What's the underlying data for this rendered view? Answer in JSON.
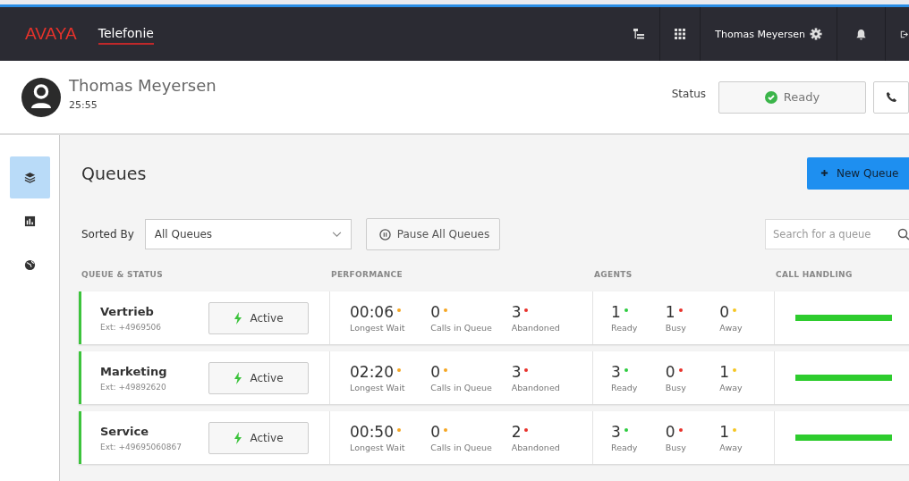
{
  "header": {
    "logo": "AVAYA",
    "app_title": "Telefonie",
    "user_name": "Thomas Meyersen"
  },
  "agent": {
    "name": "Thomas Meyersen",
    "timer": "25:55",
    "status_label": "Status",
    "status": "Ready"
  },
  "sidebar": {
    "items": [
      {
        "kind": "layers",
        "selected": true
      },
      {
        "kind": "chart",
        "selected": false
      },
      {
        "kind": "globe",
        "selected": false
      }
    ]
  },
  "page": {
    "title": "Queues",
    "new_button": "New Queue",
    "sort_label": "Sorted By",
    "sort_value": "All Queues",
    "pause_button": "Pause All Queues",
    "search": {
      "placeholder": "Search for a queue"
    }
  },
  "table": {
    "columns": [
      "QUEUE & STATUS",
      "PERFORMANCE",
      "AGENTS",
      "CALL HANDLING"
    ],
    "rows": [
      {
        "name": "Vertrieb",
        "ext": "Ext: +4969506",
        "status": "Active",
        "performance": [
          {
            "value": "00:06",
            "label": "Longest Wait",
            "color": "#f5a623"
          },
          {
            "value": "0",
            "label": "Calls in Queue",
            "color": "#f5a623"
          },
          {
            "value": "3",
            "label": "Abandoned",
            "color": "#e8322b"
          }
        ],
        "agents": [
          {
            "value": "1",
            "label": "Ready",
            "color": "#2ecc40"
          },
          {
            "value": "1",
            "label": "Busy",
            "color": "#e8322b"
          },
          {
            "value": "0",
            "label": "Away",
            "color": "#f5c623"
          }
        ]
      },
      {
        "name": "Marketing",
        "ext": "Ext: +49892620",
        "status": "Active",
        "performance": [
          {
            "value": "02:20",
            "label": "Longest Wait",
            "color": "#f5a623"
          },
          {
            "value": "0",
            "label": "Calls in Queue",
            "color": "#f5a623"
          },
          {
            "value": "3",
            "label": "Abandoned",
            "color": "#e8322b"
          }
        ],
        "agents": [
          {
            "value": "3",
            "label": "Ready",
            "color": "#2ecc40"
          },
          {
            "value": "0",
            "label": "Busy",
            "color": "#e8322b"
          },
          {
            "value": "1",
            "label": "Away",
            "color": "#f5c623"
          }
        ]
      },
      {
        "name": "Service",
        "ext": "Ext: +49695060867",
        "status": "Active",
        "performance": [
          {
            "value": "00:50",
            "label": "Longest Wait",
            "color": "#f5a623"
          },
          {
            "value": "0",
            "label": "Calls in Queue",
            "color": "#f5a623"
          },
          {
            "value": "2",
            "label": "Abandoned",
            "color": "#e8322b"
          }
        ],
        "agents": [
          {
            "value": "3",
            "label": "Ready",
            "color": "#2ecc40"
          },
          {
            "value": "0",
            "label": "Busy",
            "color": "#e8322b"
          },
          {
            "value": "1",
            "label": "Away",
            "color": "#f5c623"
          }
        ]
      }
    ]
  }
}
